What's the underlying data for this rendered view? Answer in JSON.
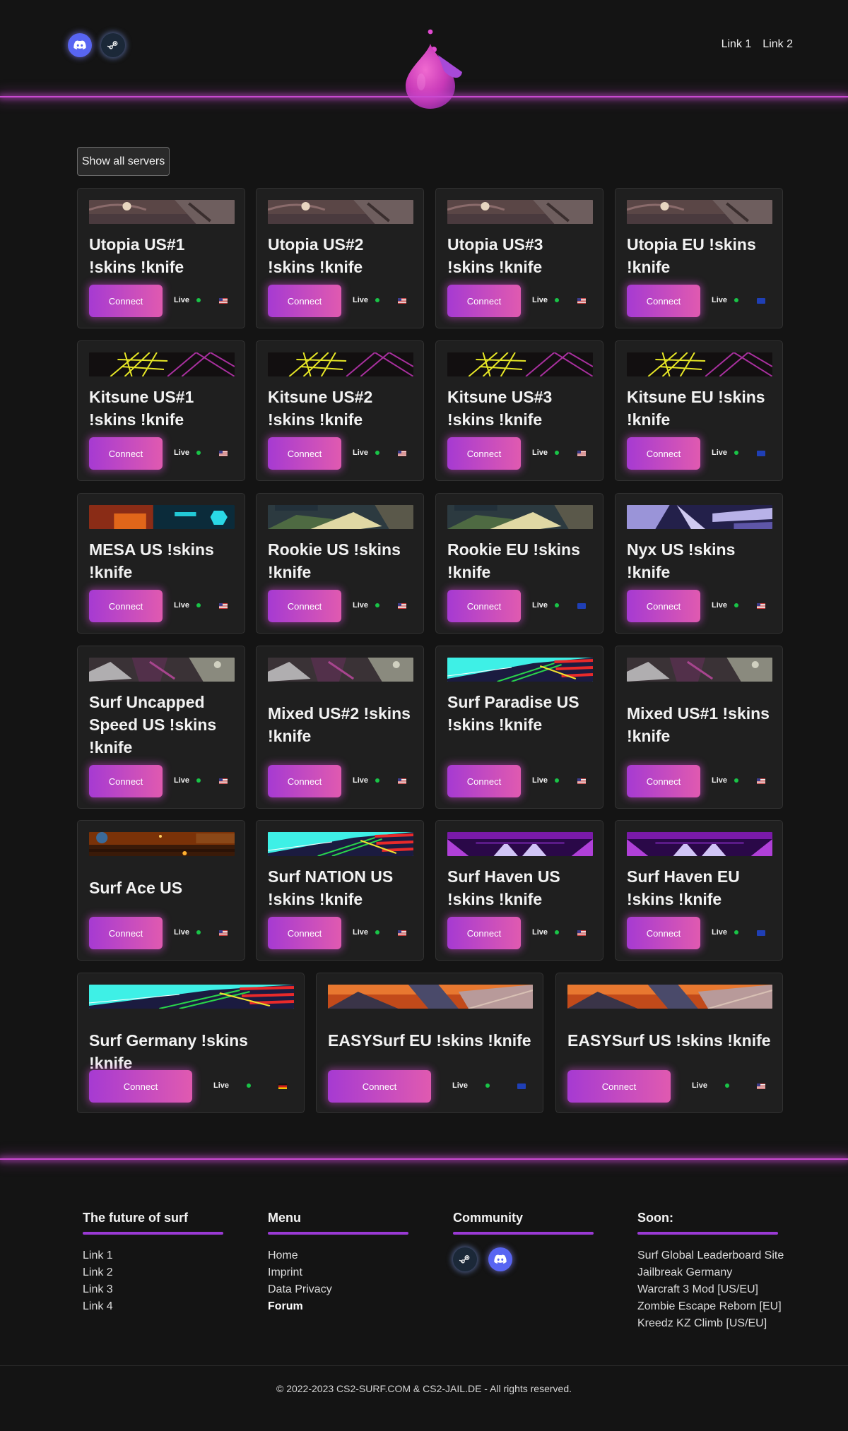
{
  "header": {
    "nav": [
      "Link 1",
      "Link 2"
    ]
  },
  "main": {
    "show_all_label": "Show all servers",
    "connect_label": "Connect",
    "live_label": "Live"
  },
  "servers": [
    {
      "name": "Utopia US#1 !skins !knife",
      "flag": "US",
      "banner": "utopia"
    },
    {
      "name": "Utopia US#2 !skins !knife",
      "flag": "US",
      "banner": "utopia"
    },
    {
      "name": "Utopia US#3 !skins !knife",
      "flag": "US",
      "banner": "utopia"
    },
    {
      "name": "Utopia EU !skins !knife",
      "flag": "EU",
      "banner": "utopia"
    },
    {
      "name": "Kitsune US#1 !skins !knife",
      "flag": "US",
      "banner": "kitsune"
    },
    {
      "name": "Kitsune US#2 !skins !knife",
      "flag": "US",
      "banner": "kitsune"
    },
    {
      "name": "Kitsune US#3 !skins !knife",
      "flag": "US",
      "banner": "kitsune"
    },
    {
      "name": "Kitsune EU !skins !knife",
      "flag": "EU",
      "banner": "kitsune"
    },
    {
      "name": "MESA US !skins !knife",
      "flag": "US",
      "banner": "mesa"
    },
    {
      "name": "Rookie US !skins !knife",
      "flag": "US",
      "banner": "rookie"
    },
    {
      "name": "Rookie EU !skins !knife",
      "flag": "EU",
      "banner": "rookie"
    },
    {
      "name": "Nyx US !skins !knife",
      "flag": "US",
      "banner": "nyx"
    },
    {
      "name": "Surf Uncapped Speed US !skins !knife",
      "flag": "US",
      "banner": "mixed"
    },
    {
      "name": "Mixed US#2 !skins !knife",
      "flag": "US",
      "banner": "mixed"
    },
    {
      "name": "Surf Paradise US !skins !knife",
      "flag": "US",
      "banner": "neon"
    },
    {
      "name": "Mixed US#1 !skins !knife",
      "flag": "US",
      "banner": "mixed"
    },
    {
      "name": "Surf Ace US",
      "flag": "US",
      "banner": "ace"
    },
    {
      "name": "Surf NATION US !skins !knife",
      "flag": "US",
      "banner": "neon"
    },
    {
      "name": "Surf Haven US !skins !knife",
      "flag": "US",
      "banner": "haven"
    },
    {
      "name": "Surf Haven EU !skins !knife",
      "flag": "EU",
      "banner": "haven"
    },
    {
      "name": "Surf Germany !skins !knife",
      "flag": "DE",
      "banner": "neon"
    },
    {
      "name": "EASYSurf EU !skins !knife",
      "flag": "EU",
      "banner": "easy"
    },
    {
      "name": "EASYSurf US !skins !knife",
      "flag": "US",
      "banner": "easy"
    }
  ],
  "footer": {
    "col1": {
      "title": "The future of surf",
      "links": [
        "Link 1",
        "Link 2",
        "Link 3",
        "Link 4"
      ]
    },
    "col2": {
      "title": "Menu",
      "links": [
        "Home",
        "Imprint",
        "Data Privacy",
        "Forum"
      ]
    },
    "col3": {
      "title": "Community"
    },
    "col4": {
      "title": "Soon:",
      "items": [
        "Surf Global Leaderboard Site",
        "Jailbreak Germany",
        "Warcraft 3 Mod [US/EU]",
        "Zombie Escape Reborn [EU]",
        "Kreedz KZ Climb [US/EU]"
      ]
    },
    "copyright": "© 2022-2023 CS2-SURF.COM & CS2-JAIL.DE - All rights reserved."
  },
  "icons": {
    "discord": "discord-icon",
    "steam": "steam-icon",
    "logo": "droplet-logo-icon"
  },
  "colors": {
    "accent": "#c94ad0",
    "button_start": "#a63ad2",
    "button_end": "#e05ab0",
    "live_dot": "#19c447",
    "background": "#141414",
    "card": "#1f1f1f"
  }
}
